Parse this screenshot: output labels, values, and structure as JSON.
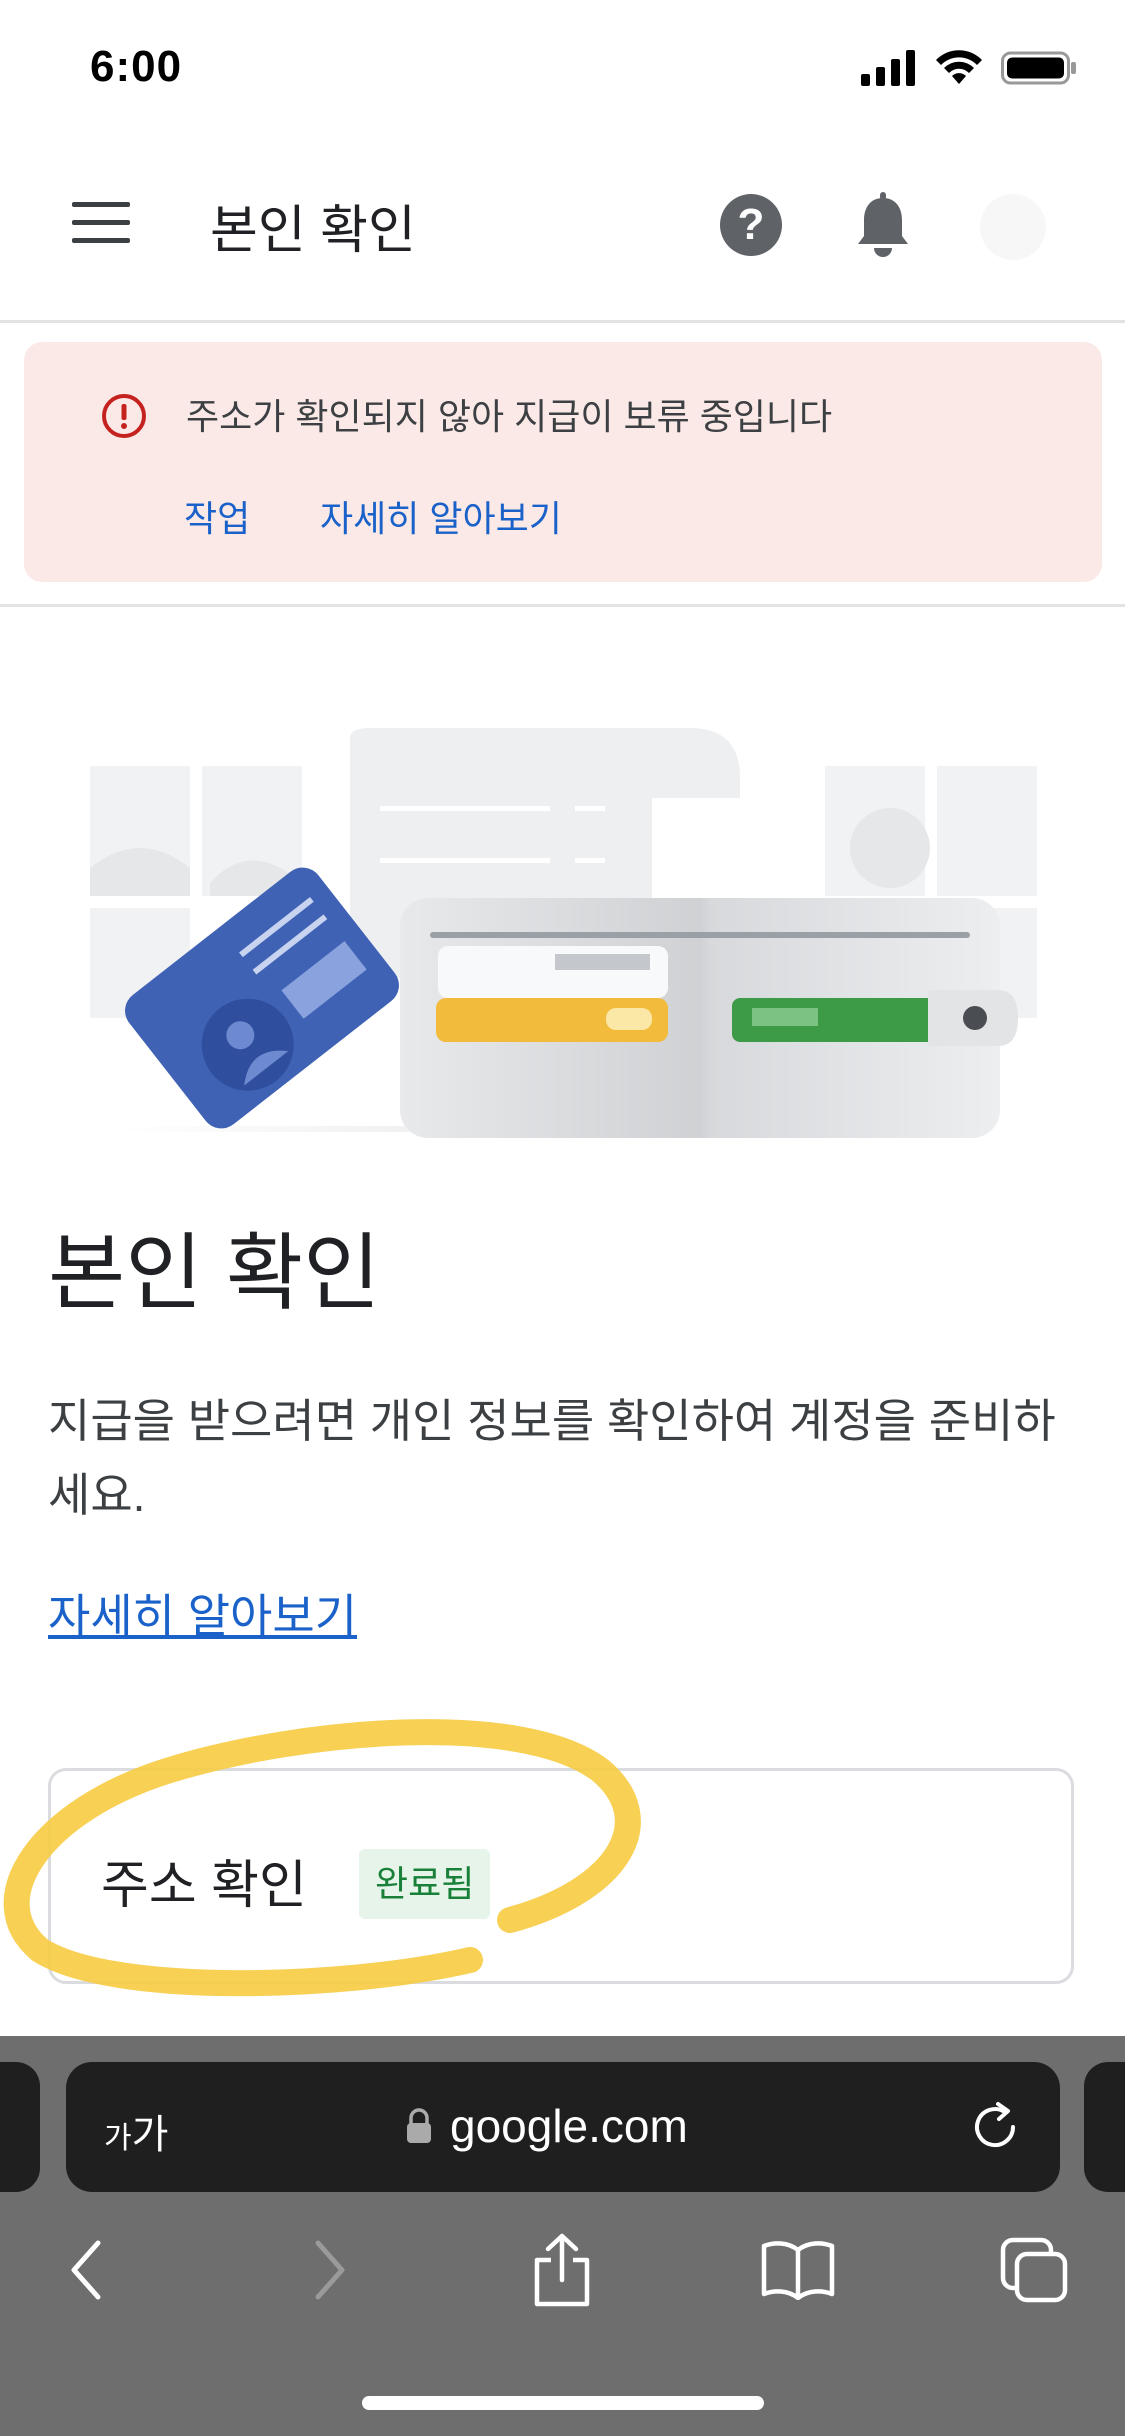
{
  "status_bar": {
    "time": "6:00"
  },
  "header": {
    "title": "본인 확인"
  },
  "alert": {
    "message": "주소가 확인되지 않아 지급이 보류 중입니다",
    "action_work": "작업",
    "action_learn_more": "자세히 알아보기"
  },
  "main": {
    "title": "본인 확인",
    "description": "지급을 받으려면 개인 정보를 확인하여 계정을 준비하세요.",
    "learn_more_link": "자세히 알아보기",
    "verify_card": {
      "label": "주소 확인",
      "status": "완료됨"
    }
  },
  "browser": {
    "text_size_small": "가",
    "text_size_large": "가",
    "url": "google.com"
  },
  "colors": {
    "accent_link": "#1a62c9",
    "alert_bg": "#fbe9e7",
    "alert_icon": "#c5221f",
    "success_text": "#188038",
    "success_bg": "#e6f4ea",
    "highlight": "#f6cc45"
  },
  "icons": {
    "header": [
      "menu-icon",
      "help-icon",
      "bell-icon",
      "avatar"
    ],
    "alert": "error-icon",
    "browser_toolbar": [
      "back-icon",
      "forward-icon",
      "share-icon",
      "bookmarks-icon",
      "tabs-icon"
    ],
    "address_bar": [
      "lock-icon",
      "reload-icon"
    ]
  }
}
